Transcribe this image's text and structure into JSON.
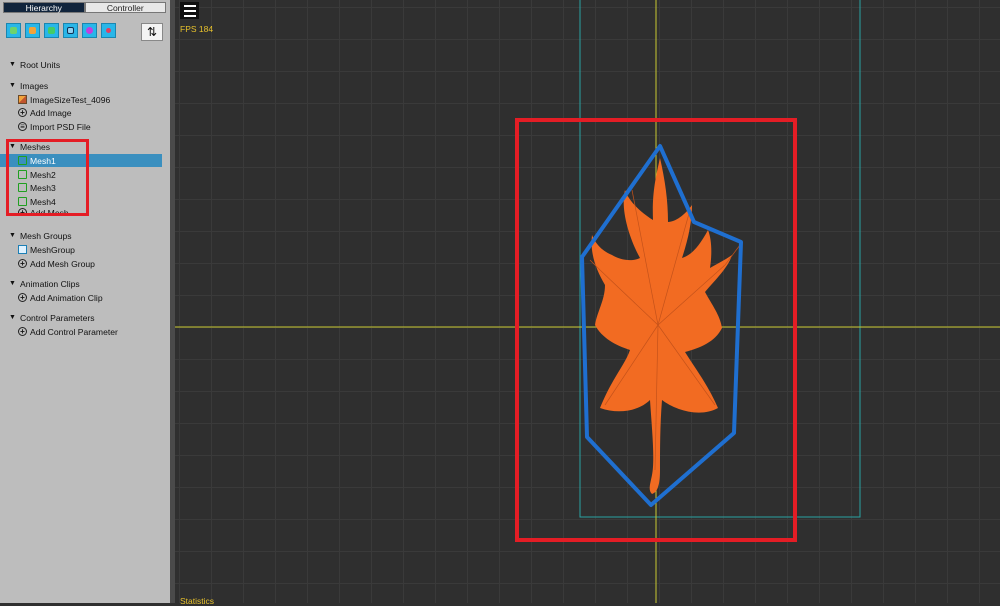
{
  "tabs": [
    {
      "label": "Hierarchy",
      "active": true
    },
    {
      "label": "Controller",
      "active": false
    }
  ],
  "toolbar": {
    "icons": [
      "unit-tool-icon",
      "image-tool-icon",
      "mesh-tool-icon",
      "mesh-group-tool-icon",
      "animation-tool-icon",
      "parameter-tool-icon"
    ],
    "sort_symbol": "⇅"
  },
  "tree": {
    "root_units": "Root Units",
    "images": {
      "header": "Images",
      "items": [
        "ImageSizeTest_4096"
      ],
      "add": "Add Image",
      "import": "Import PSD File"
    },
    "meshes": {
      "header": "Meshes",
      "items": [
        "Mesh1",
        "Mesh2",
        "Mesh3",
        "Mesh4"
      ],
      "selected": "Mesh1",
      "add": "Add Mesh"
    },
    "mesh_groups": {
      "header": "Mesh Groups",
      "items": [
        "MeshGroup"
      ],
      "add": "Add Mesh Group"
    },
    "animation_clips": {
      "header": "Animation Clips",
      "add": "Add Animation Clip"
    },
    "control_parameters": {
      "header": "Control Parameters",
      "add": "Add Control Parameter"
    }
  },
  "viewport": {
    "fps": "FPS 184",
    "statistics": "Statistics"
  },
  "colors": {
    "selection": "#3a8fbf",
    "highlight_box": "#e41d25",
    "mesh_outline": "#1f6fd0",
    "leaf": "#f26b22",
    "axis": "#c8c830",
    "canvas_frame": "#2aa3a3"
  }
}
